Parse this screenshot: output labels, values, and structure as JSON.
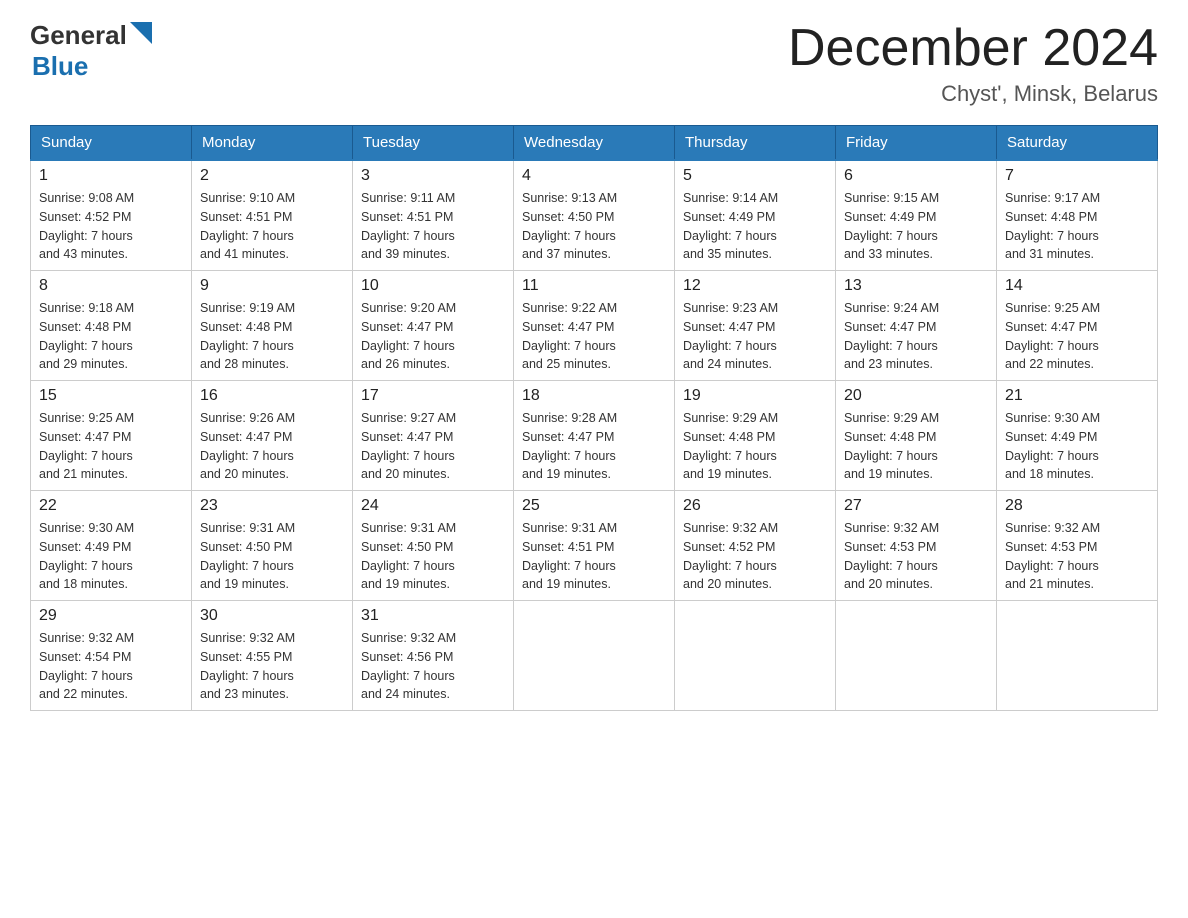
{
  "header": {
    "logo_general": "General",
    "logo_blue": "Blue",
    "title": "December 2024",
    "subtitle": "Chyst', Minsk, Belarus"
  },
  "columns": [
    "Sunday",
    "Monday",
    "Tuesday",
    "Wednesday",
    "Thursday",
    "Friday",
    "Saturday"
  ],
  "weeks": [
    [
      {
        "day": "1",
        "sunrise": "Sunrise: 9:08 AM",
        "sunset": "Sunset: 4:52 PM",
        "daylight": "Daylight: 7 hours",
        "daylight2": "and 43 minutes."
      },
      {
        "day": "2",
        "sunrise": "Sunrise: 9:10 AM",
        "sunset": "Sunset: 4:51 PM",
        "daylight": "Daylight: 7 hours",
        "daylight2": "and 41 minutes."
      },
      {
        "day": "3",
        "sunrise": "Sunrise: 9:11 AM",
        "sunset": "Sunset: 4:51 PM",
        "daylight": "Daylight: 7 hours",
        "daylight2": "and 39 minutes."
      },
      {
        "day": "4",
        "sunrise": "Sunrise: 9:13 AM",
        "sunset": "Sunset: 4:50 PM",
        "daylight": "Daylight: 7 hours",
        "daylight2": "and 37 minutes."
      },
      {
        "day": "5",
        "sunrise": "Sunrise: 9:14 AM",
        "sunset": "Sunset: 4:49 PM",
        "daylight": "Daylight: 7 hours",
        "daylight2": "and 35 minutes."
      },
      {
        "day": "6",
        "sunrise": "Sunrise: 9:15 AM",
        "sunset": "Sunset: 4:49 PM",
        "daylight": "Daylight: 7 hours",
        "daylight2": "and 33 minutes."
      },
      {
        "day": "7",
        "sunrise": "Sunrise: 9:17 AM",
        "sunset": "Sunset: 4:48 PM",
        "daylight": "Daylight: 7 hours",
        "daylight2": "and 31 minutes."
      }
    ],
    [
      {
        "day": "8",
        "sunrise": "Sunrise: 9:18 AM",
        "sunset": "Sunset: 4:48 PM",
        "daylight": "Daylight: 7 hours",
        "daylight2": "and 29 minutes."
      },
      {
        "day": "9",
        "sunrise": "Sunrise: 9:19 AM",
        "sunset": "Sunset: 4:48 PM",
        "daylight": "Daylight: 7 hours",
        "daylight2": "and 28 minutes."
      },
      {
        "day": "10",
        "sunrise": "Sunrise: 9:20 AM",
        "sunset": "Sunset: 4:47 PM",
        "daylight": "Daylight: 7 hours",
        "daylight2": "and 26 minutes."
      },
      {
        "day": "11",
        "sunrise": "Sunrise: 9:22 AM",
        "sunset": "Sunset: 4:47 PM",
        "daylight": "Daylight: 7 hours",
        "daylight2": "and 25 minutes."
      },
      {
        "day": "12",
        "sunrise": "Sunrise: 9:23 AM",
        "sunset": "Sunset: 4:47 PM",
        "daylight": "Daylight: 7 hours",
        "daylight2": "and 24 minutes."
      },
      {
        "day": "13",
        "sunrise": "Sunrise: 9:24 AM",
        "sunset": "Sunset: 4:47 PM",
        "daylight": "Daylight: 7 hours",
        "daylight2": "and 23 minutes."
      },
      {
        "day": "14",
        "sunrise": "Sunrise: 9:25 AM",
        "sunset": "Sunset: 4:47 PM",
        "daylight": "Daylight: 7 hours",
        "daylight2": "and 22 minutes."
      }
    ],
    [
      {
        "day": "15",
        "sunrise": "Sunrise: 9:25 AM",
        "sunset": "Sunset: 4:47 PM",
        "daylight": "Daylight: 7 hours",
        "daylight2": "and 21 minutes."
      },
      {
        "day": "16",
        "sunrise": "Sunrise: 9:26 AM",
        "sunset": "Sunset: 4:47 PM",
        "daylight": "Daylight: 7 hours",
        "daylight2": "and 20 minutes."
      },
      {
        "day": "17",
        "sunrise": "Sunrise: 9:27 AM",
        "sunset": "Sunset: 4:47 PM",
        "daylight": "Daylight: 7 hours",
        "daylight2": "and 20 minutes."
      },
      {
        "day": "18",
        "sunrise": "Sunrise: 9:28 AM",
        "sunset": "Sunset: 4:47 PM",
        "daylight": "Daylight: 7 hours",
        "daylight2": "and 19 minutes."
      },
      {
        "day": "19",
        "sunrise": "Sunrise: 9:29 AM",
        "sunset": "Sunset: 4:48 PM",
        "daylight": "Daylight: 7 hours",
        "daylight2": "and 19 minutes."
      },
      {
        "day": "20",
        "sunrise": "Sunrise: 9:29 AM",
        "sunset": "Sunset: 4:48 PM",
        "daylight": "Daylight: 7 hours",
        "daylight2": "and 19 minutes."
      },
      {
        "day": "21",
        "sunrise": "Sunrise: 9:30 AM",
        "sunset": "Sunset: 4:49 PM",
        "daylight": "Daylight: 7 hours",
        "daylight2": "and 18 minutes."
      }
    ],
    [
      {
        "day": "22",
        "sunrise": "Sunrise: 9:30 AM",
        "sunset": "Sunset: 4:49 PM",
        "daylight": "Daylight: 7 hours",
        "daylight2": "and 18 minutes."
      },
      {
        "day": "23",
        "sunrise": "Sunrise: 9:31 AM",
        "sunset": "Sunset: 4:50 PM",
        "daylight": "Daylight: 7 hours",
        "daylight2": "and 19 minutes."
      },
      {
        "day": "24",
        "sunrise": "Sunrise: 9:31 AM",
        "sunset": "Sunset: 4:50 PM",
        "daylight": "Daylight: 7 hours",
        "daylight2": "and 19 minutes."
      },
      {
        "day": "25",
        "sunrise": "Sunrise: 9:31 AM",
        "sunset": "Sunset: 4:51 PM",
        "daylight": "Daylight: 7 hours",
        "daylight2": "and 19 minutes."
      },
      {
        "day": "26",
        "sunrise": "Sunrise: 9:32 AM",
        "sunset": "Sunset: 4:52 PM",
        "daylight": "Daylight: 7 hours",
        "daylight2": "and 20 minutes."
      },
      {
        "day": "27",
        "sunrise": "Sunrise: 9:32 AM",
        "sunset": "Sunset: 4:53 PM",
        "daylight": "Daylight: 7 hours",
        "daylight2": "and 20 minutes."
      },
      {
        "day": "28",
        "sunrise": "Sunrise: 9:32 AM",
        "sunset": "Sunset: 4:53 PM",
        "daylight": "Daylight: 7 hours",
        "daylight2": "and 21 minutes."
      }
    ],
    [
      {
        "day": "29",
        "sunrise": "Sunrise: 9:32 AM",
        "sunset": "Sunset: 4:54 PM",
        "daylight": "Daylight: 7 hours",
        "daylight2": "and 22 minutes."
      },
      {
        "day": "30",
        "sunrise": "Sunrise: 9:32 AM",
        "sunset": "Sunset: 4:55 PM",
        "daylight": "Daylight: 7 hours",
        "daylight2": "and 23 minutes."
      },
      {
        "day": "31",
        "sunrise": "Sunrise: 9:32 AM",
        "sunset": "Sunset: 4:56 PM",
        "daylight": "Daylight: 7 hours",
        "daylight2": "and 24 minutes."
      },
      null,
      null,
      null,
      null
    ]
  ]
}
